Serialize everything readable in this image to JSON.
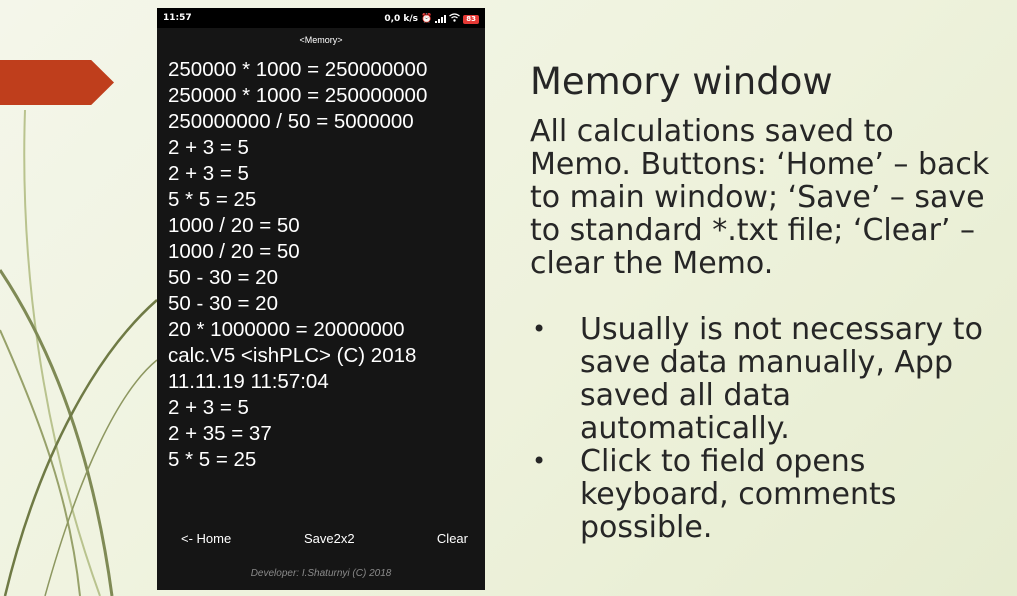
{
  "statusbar": {
    "time": "11:57",
    "net_speed": "0,0 k/s",
    "battery": "83",
    "icons": [
      "alarm-icon",
      "signal-bars-icon",
      "wifi-icon",
      "battery-icon"
    ]
  },
  "phone": {
    "title": "<Memory>",
    "memo_lines": [
      "250000 * 1000 = 250000000",
      "250000 * 1000 = 250000000",
      "250000000 / 50 = 5000000",
      "2 + 3 = 5",
      "2 + 3 = 5",
      "5 * 5 = 25",
      "1000 / 20 = 50",
      "1000 / 20 = 50",
      "50 - 30 = 20",
      "50 - 30 = 20",
      "20 * 1000000 = 20000000",
      "calc.V5 <ishPLC> (C) 2018",
      "11.11.19 11:57:04",
      "2 + 3 = 5",
      "2 + 35 = 37",
      "5 * 5 = 25"
    ],
    "buttons": {
      "home": "<- Home",
      "save": "Save2x2",
      "clear": "Clear"
    },
    "developer": "Developer: I.Shaturnyi (C) 2018"
  },
  "slide": {
    "title": "Memory window",
    "body": "All calculations saved to Memo. Buttons: ‘Home’ – back to main window; ‘Save’ – save to standard *.txt file; ‘Clear’ – clear the Memo.",
    "bullets": [
      "Usually is not necessary to save data manually, App saved all data automatically.",
      "Click to field opens keyboard, comments possible."
    ]
  },
  "colors": {
    "accent_arrow": "#bf3e1c",
    "phone_bg": "#151515",
    "slide_text": "#262626",
    "battery": "#e53935"
  }
}
